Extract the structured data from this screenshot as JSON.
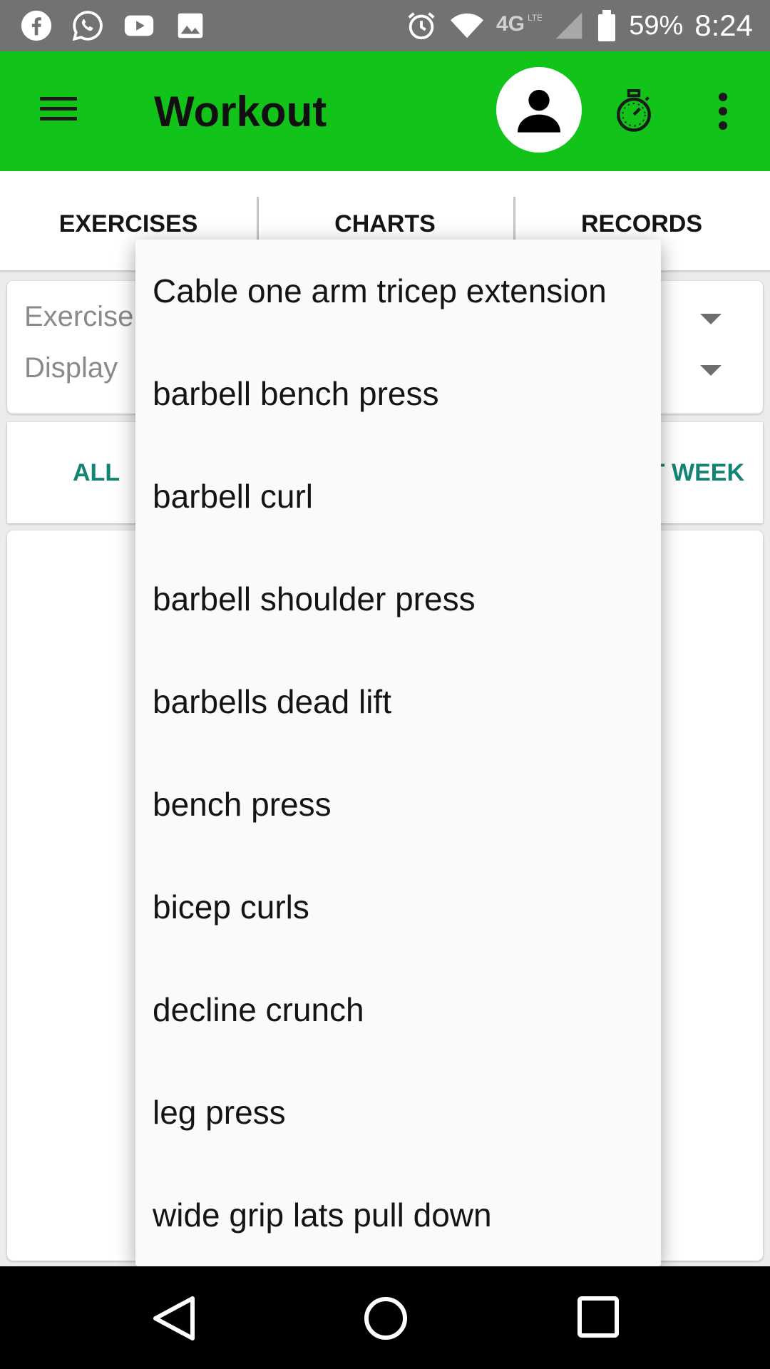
{
  "status_bar": {
    "notification_icons": [
      "facebook-icon",
      "whatsapp-icon",
      "youtube-icon",
      "image-icon"
    ],
    "system_icons": [
      "alarm-icon",
      "wifi-icon",
      "4g-lte-icon",
      "signal-icon",
      "battery-icon"
    ],
    "battery": "59%",
    "time": "8:24"
  },
  "app_bar": {
    "title": "Workout",
    "color": "#12c41a"
  },
  "tabs": [
    {
      "label": "EXERCISES"
    },
    {
      "label": "CHARTS"
    },
    {
      "label": "RECORDS"
    }
  ],
  "selectors": {
    "exercise_label": "Exercise",
    "display_label": "Display"
  },
  "period": {
    "all_label": "ALL",
    "last_week_partial": "T WEEK"
  },
  "dropdown": {
    "items": [
      "Cable one arm tricep extension",
      "barbell bench press",
      "barbell curl",
      "barbell shoulder press",
      "barbells dead lift",
      "bench press",
      "bicep curls",
      "decline crunch",
      "leg press",
      "wide grip lats pull down"
    ]
  },
  "accent_color": "#128473"
}
